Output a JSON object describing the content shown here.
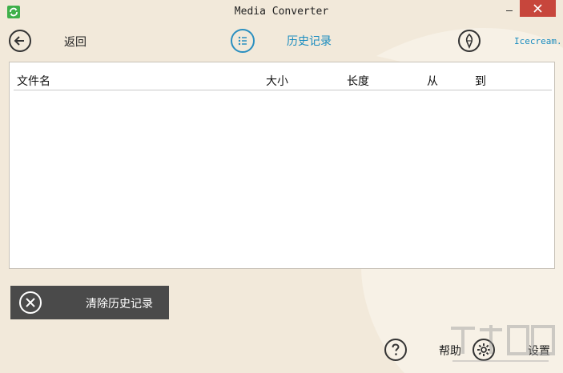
{
  "window": {
    "title": "Media Converter"
  },
  "nav": {
    "back_label": "返回",
    "history_label": "历史记录",
    "brand_label": "Icecream..."
  },
  "table": {
    "columns": [
      "文件名",
      "大小",
      "长度",
      "从",
      "到"
    ],
    "rows": []
  },
  "actions": {
    "clear_history_label": "清除历史记录"
  },
  "footer": {
    "help_label": "帮助",
    "settings_label": "设置"
  },
  "colors": {
    "background": "#f2e9da",
    "accent": "#1a8cbf",
    "close": "#c7463c",
    "app_icon": "#3fb04a"
  },
  "icons": {
    "app": "refresh-icon",
    "back": "arrow-left-icon",
    "history": "list-icon",
    "brand": "icecream-icon",
    "clear": "close-circle-icon",
    "help": "question-icon",
    "settings": "gear-icon"
  }
}
